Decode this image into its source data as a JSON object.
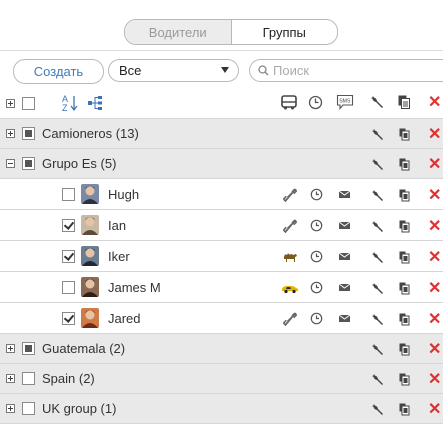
{
  "tabs": [
    "Водители",
    "Группы"
  ],
  "toolbar": {
    "create_label": "Создать",
    "filter_value": "Все",
    "search_placeholder": "Поиск"
  },
  "columns": {
    "sms_label": "SMS"
  },
  "colors": {
    "accent": "#3e7cbb",
    "delete": "#e03030",
    "group_bg": "#e9e9e9"
  },
  "groups": [
    {
      "label": "Camioneros (13)",
      "expanded": false,
      "checkbox": "partial"
    },
    {
      "label": "Grupo Es (5)",
      "expanded": true,
      "checkbox": "partial"
    },
    {
      "label": "Guatemala (2)",
      "expanded": false,
      "checkbox": "partial"
    },
    {
      "label": "Spain (2)",
      "expanded": false,
      "checkbox": "unchecked"
    },
    {
      "label": "UK group (1)",
      "expanded": false,
      "checkbox": "unchecked"
    }
  ],
  "drivers": [
    {
      "name": "Hugh",
      "checked": false,
      "vehicle_icon": "link-icon"
    },
    {
      "name": "Ian",
      "checked": true,
      "vehicle_icon": "link-icon"
    },
    {
      "name": "Iker",
      "checked": true,
      "vehicle_icon": "camel-icon"
    },
    {
      "name": "James M",
      "checked": false,
      "vehicle_icon": "car-icon"
    },
    {
      "name": "Jared",
      "checked": true,
      "vehicle_icon": "link-icon"
    }
  ]
}
